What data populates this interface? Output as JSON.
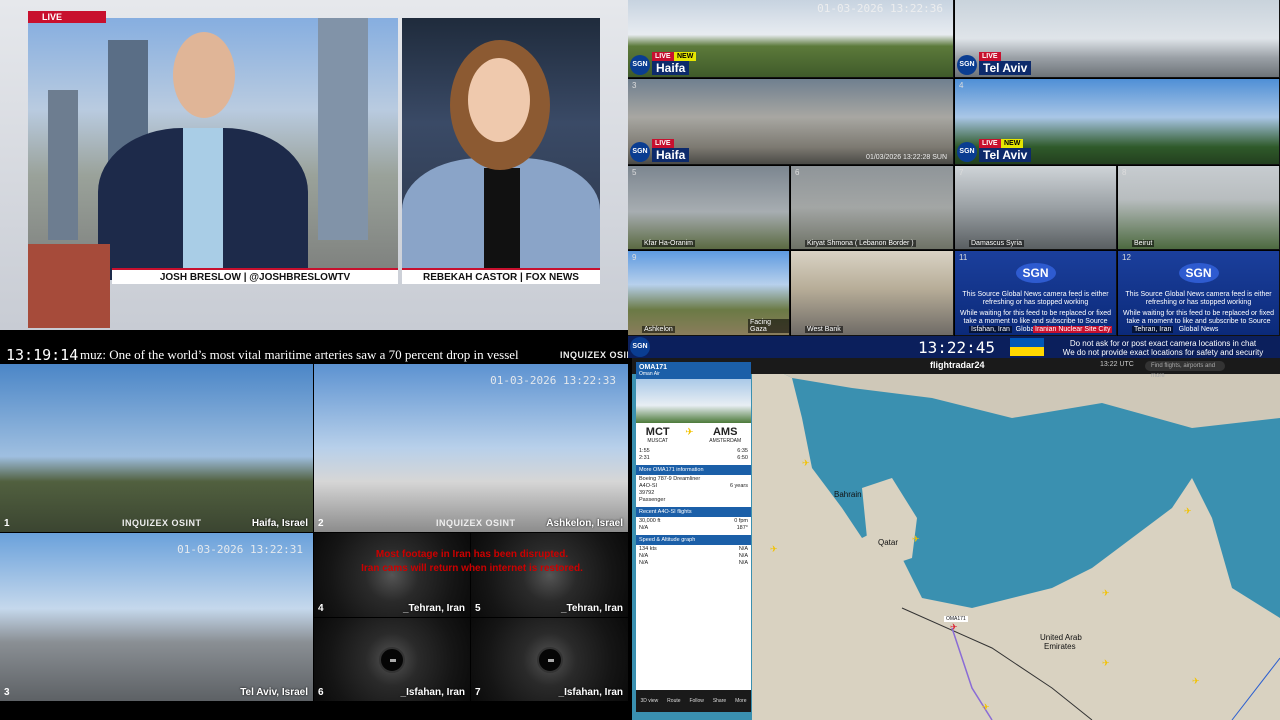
{
  "news": {
    "live_tag": "LIVE",
    "anchor_left": "JOSH BRESLOW | @JOSHBRESLOWTV",
    "anchor_right": "REBEKAH CASTOR | FOX NEWS"
  },
  "ticker": {
    "time": "13:19:14",
    "text": "muz: One of the world’s most vital maritime arteries saw a 70 percent drop in vessel",
    "watermark": "INQUIZEX OSINT"
  },
  "osint": {
    "timestamp": "01-03-2026 13:22:33",
    "timestamp_b": "01-03-2026 13:22:31",
    "watermark": "INQUIZEX OSINT",
    "thermal_message": [
      "Most footage in Iran has been disrupted.",
      "Iran cams will return when internet is restored."
    ],
    "cams": [
      {
        "num": "1",
        "loc": "Haifa, Israel"
      },
      {
        "num": "2",
        "loc": "Ashkelon, Israel"
      },
      {
        "num": "3",
        "loc": "Tel Aviv, Israel"
      },
      {
        "num": "4",
        "loc": "_Tehran, Iran"
      },
      {
        "num": "5",
        "loc": "_Tehran, Iran"
      },
      {
        "num": "6",
        "loc": "_Isfahan, Iran"
      },
      {
        "num": "7",
        "loc": "_Isfahan, Iran"
      }
    ]
  },
  "sgn": {
    "logo": "SGN",
    "live": "LIVE",
    "new": "NEW",
    "timestamp_top": "01-03-2026 13:22:36",
    "timestamp_3": "01/03/2026 13:22:28 SUN",
    "big_tiles": [
      {
        "num": "1",
        "city": "Haifa",
        "new": true
      },
      {
        "num": "2",
        "city": "Tel Aviv",
        "new": false
      },
      {
        "num": "3",
        "city": "Haifa",
        "new": false
      },
      {
        "num": "4",
        "city": "Tel Aviv",
        "new": true
      }
    ],
    "small_tiles": [
      {
        "num": "5",
        "label": "Kfar Ha-Oranim"
      },
      {
        "num": "6",
        "label": "Kiryat Shmona ( Lebanon Border )"
      },
      {
        "num": "7",
        "label": "Damascus Syria"
      },
      {
        "num": "8",
        "label": "Beirut"
      },
      {
        "num": "9",
        "label": "Ashkelon"
      },
      {
        "num": "",
        "label": "Facing Gaza"
      },
      {
        "num": "10",
        "label": "West Bank"
      }
    ],
    "cards": [
      {
        "num": "11",
        "msg1": "This Source Global News camera feed is either refreshing or has stopped working",
        "msg2": "While waiting for this feed to be replaced or fixed take a moment to like and subscribe to Source Global News",
        "label": "Isfahan, Iran",
        "label2": "Iranian Nuclear Site City"
      },
      {
        "num": "12",
        "msg1": "This Source Global News camera feed is either refreshing or has stopped working",
        "msg2": "While waiting for this feed to be replaced or fixed take a moment to like and subscribe to Source Global News",
        "label": "Tehran, Iran",
        "label2": ""
      }
    ],
    "clock": "13:22:45",
    "note1": "Do not ask for or post exact camera locations in chat",
    "note2": "We do not provide exact locations for safety and security reasons"
  },
  "flightradar": {
    "logo": "flightradar24",
    "search_placeholder": "Find flights, airports and more",
    "clock": "13:22 UTC",
    "flight": {
      "callsign": "OMA171",
      "airline": "Oman Air",
      "from_code": "MCT",
      "from_city": "MUSCAT",
      "to_code": "AMS",
      "to_city": "AMSTERDAM",
      "sched_dep": "1:55",
      "sched_arr": "6:35",
      "actual_dep": "2:31",
      "est_arr": "6:50",
      "aircraft_type": "Boeing 787-9 Dreamliner",
      "registration": "A4O-SI",
      "serial": "39792",
      "age": "6 years",
      "category": "Passenger",
      "altitude": "30,000 ft",
      "v_speed": "0 fpm",
      "gps_alt": "N/A",
      "track": "187°",
      "ground_speed": "134 kts",
      "true_airspeed": "N/A",
      "ias": "N/A",
      "mach": "N/A",
      "wind": "N/A",
      "temperature": "N/A",
      "sec_more": "More OMA171 information",
      "sec_recent": "Recent A4O-SI flights",
      "sec_speed": "Speed & Altitude graph"
    },
    "map_labels": {
      "bahrain": "Bahrain",
      "qatar": "Qatar",
      "uae1": "United Arab",
      "uae2": "Emirates",
      "callsign_tag": "OMA171"
    },
    "nav": [
      "3D view",
      "Route",
      "Follow",
      "Share",
      "More"
    ]
  }
}
